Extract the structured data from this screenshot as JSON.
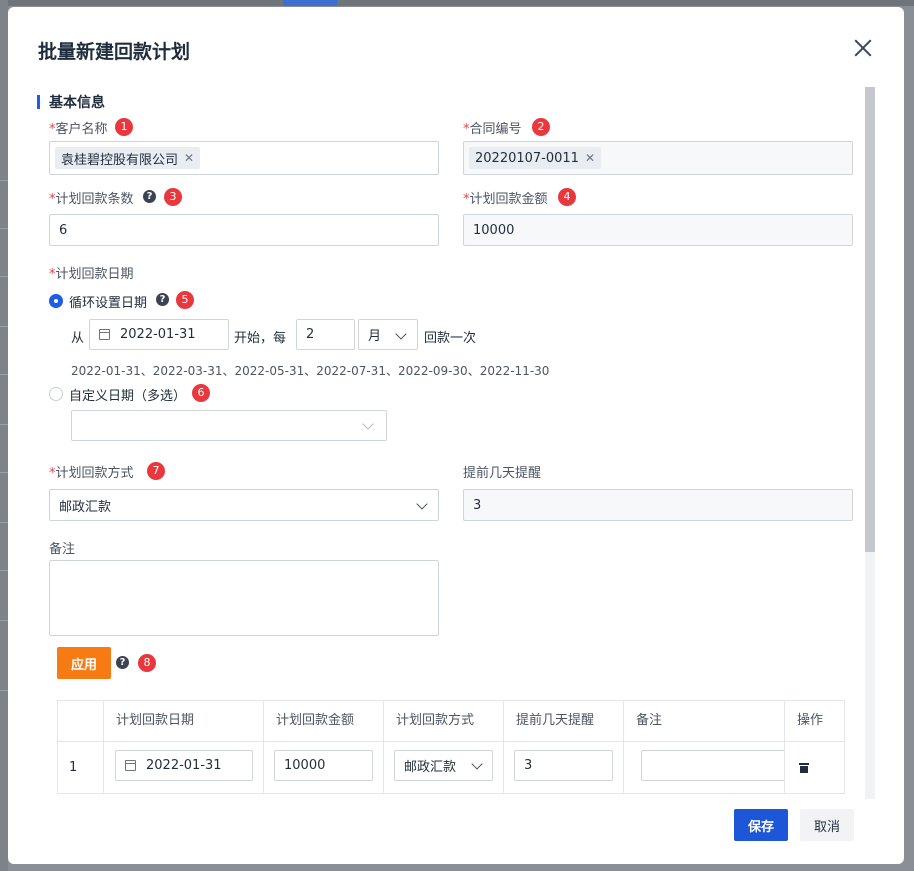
{
  "dialog": {
    "title": "批量新建回款计划",
    "section_title": "基本信息"
  },
  "fields": {
    "customer": {
      "label": "客户名称",
      "required_mark": "*",
      "badge": "1",
      "tag": "袁桂碧控股有限公司"
    },
    "contract": {
      "label": "合同编号",
      "required_mark": "*",
      "badge": "2",
      "tag": "20220107-0011"
    },
    "count": {
      "label": "计划回款条数",
      "required_mark": "*",
      "badge": "3",
      "value": "6"
    },
    "amount": {
      "label": "计划回款金额",
      "required_mark": "*",
      "badge": "4",
      "value": "10000"
    },
    "date": {
      "label": "计划回款日期",
      "required_mark": "*",
      "cycle": {
        "label": "循环设置日期",
        "badge": "5",
        "selected": true,
        "from_text": "从",
        "start_date": "2022-01-31",
        "start_text": "开始，每",
        "interval": "2",
        "unit": "月",
        "suffix": "回款一次",
        "preview": "2022-01-31、2022-03-31、2022-05-31、2022-07-31、2022-09-30、2022-11-30"
      },
      "custom": {
        "label": "自定义日期（多选）",
        "badge": "6",
        "selected": false,
        "value": ""
      }
    },
    "method": {
      "label": "计划回款方式",
      "required_mark": "*",
      "badge": "7",
      "value": "邮政汇款"
    },
    "remind": {
      "label": "提前几天提醒",
      "value": "3"
    },
    "note": {
      "label": "备注",
      "value": ""
    }
  },
  "apply": {
    "label": "应用",
    "badge": "8"
  },
  "table": {
    "headers": [
      "计划回款日期",
      "计划回款金额",
      "计划回款方式",
      "提前几天提醒",
      "备注",
      "操作"
    ],
    "rows": [
      {
        "index": "1",
        "date": "2022-01-31",
        "amount": "10000",
        "method": "邮政汇款",
        "remind": "3",
        "note": ""
      }
    ]
  },
  "footer": {
    "save": "保存",
    "cancel": "取消"
  },
  "icons": {
    "help": "question-circle-icon",
    "close": "close-icon",
    "calendar": "calendar-icon",
    "delete": "trash-icon"
  },
  "colors": {
    "primary": "#1d56d6",
    "accent": "#f57b12",
    "required": "#f04141",
    "badge": "#e8383d"
  }
}
